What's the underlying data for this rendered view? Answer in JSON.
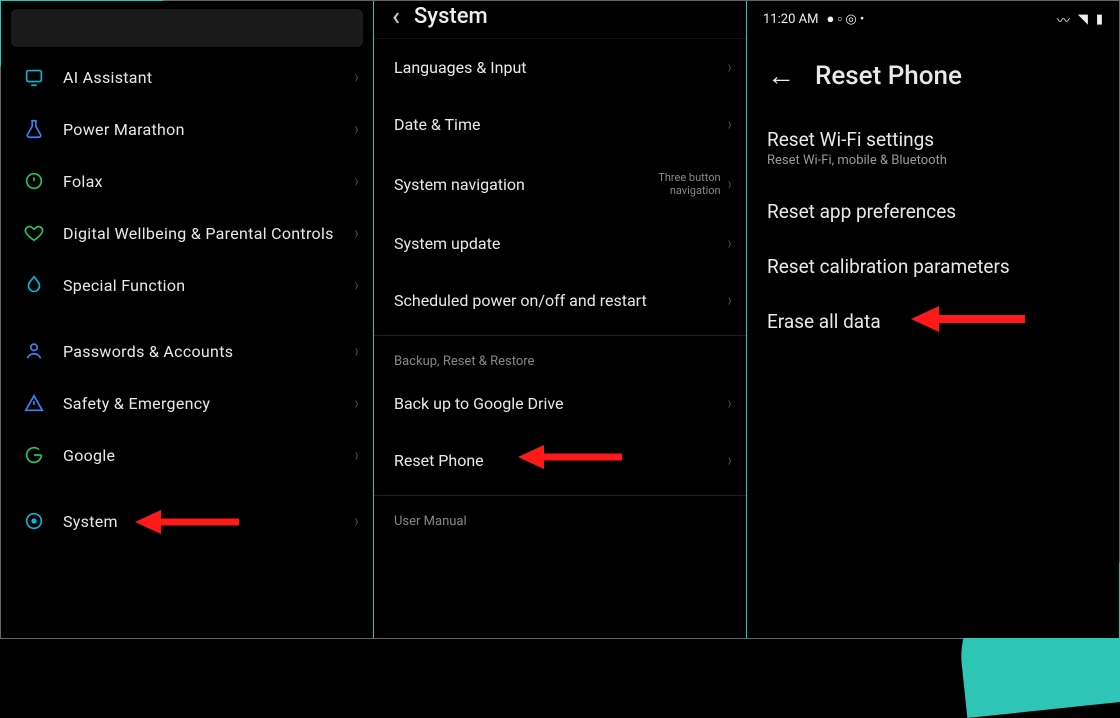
{
  "panel1": {
    "items": [
      {
        "icon": "ai-assistant-icon",
        "label": "AI Assistant"
      },
      {
        "icon": "flask-icon",
        "label": "Power Marathon"
      },
      {
        "icon": "power-icon",
        "label": "Folax"
      },
      {
        "icon": "heart-icon",
        "label": "Digital Wellbeing & Parental Controls"
      },
      {
        "icon": "special-icon",
        "label": "Special Function"
      },
      {
        "icon": "person-icon",
        "label": "Passwords & Accounts"
      },
      {
        "icon": "warning-icon",
        "label": "Safety & Emergency"
      },
      {
        "icon": "google-icon",
        "label": "Google"
      },
      {
        "icon": "system-icon",
        "label": "System"
      }
    ]
  },
  "panel2": {
    "title": "System",
    "items_top": [
      {
        "label": "Languages & Input"
      },
      {
        "label": "Date & Time"
      },
      {
        "label": "System navigation",
        "sub": "Three button navigation"
      },
      {
        "label": "System update"
      },
      {
        "label": "Scheduled power on/off and restart"
      }
    ],
    "section_backup": "Backup, Reset & Restore",
    "items_backup": [
      {
        "label": "Back up to Google Drive"
      },
      {
        "label": "Reset Phone"
      }
    ],
    "section_manual": "User Manual"
  },
  "panel3": {
    "time": "11:20 AM",
    "title": "Reset Phone",
    "items": [
      {
        "label": "Reset Wi-Fi settings",
        "sub": "Reset Wi-Fi, mobile & Bluetooth"
      },
      {
        "label": "Reset app preferences"
      },
      {
        "label": "Reset calibration parameters"
      },
      {
        "label": "Erase all data"
      }
    ]
  }
}
